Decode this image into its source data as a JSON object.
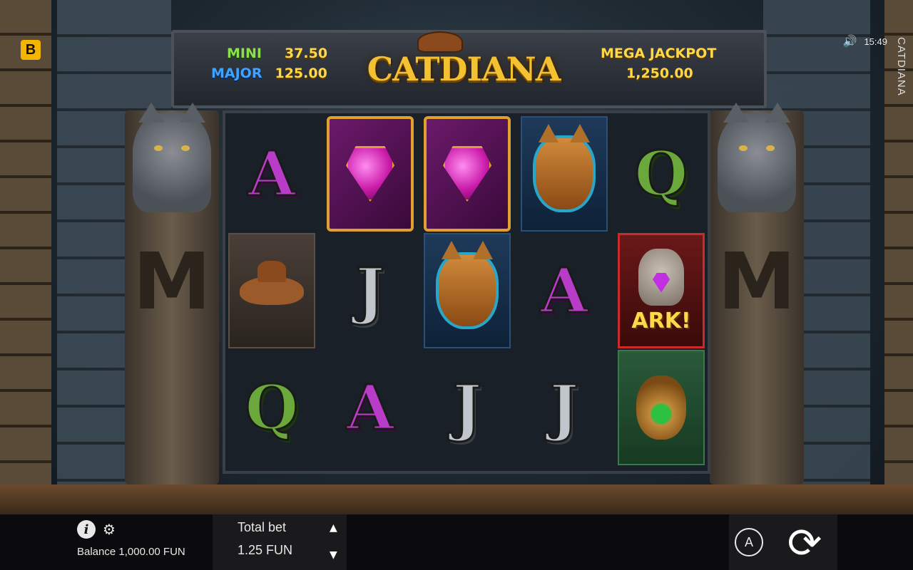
{
  "app": {
    "brand_badge": "B",
    "time": "15:49",
    "vertical_title": "CATDIANA"
  },
  "jackpots": {
    "mini_label": "MINI",
    "mini_value": "37.50",
    "major_label": "MAJOR",
    "major_value": "125.00",
    "mega_label": "MEGA JACKPOT",
    "mega_value": "1,250.00"
  },
  "logo": {
    "text": "CATDIANA"
  },
  "reels": {
    "grid": [
      [
        "A",
        "hat",
        "Q"
      ],
      [
        "gem",
        "J",
        "A"
      ],
      [
        "gem",
        "mask",
        "J"
      ],
      [
        "mask",
        "A",
        "J"
      ],
      [
        "Q",
        "ark",
        "amulet"
      ]
    ],
    "ark_text": "ARK!"
  },
  "bottom": {
    "balance": "Balance 1,000.00 FUN",
    "bet_label": "Total bet",
    "bet_value": "1.25 FUN",
    "autoplay_label": "A"
  },
  "icons": {
    "info": "info-icon",
    "settings": "gear-icon",
    "sound": "speaker-icon",
    "bet_up": "triangle-up-icon",
    "bet_down": "triangle-down-icon",
    "spin": "spin-icon"
  }
}
